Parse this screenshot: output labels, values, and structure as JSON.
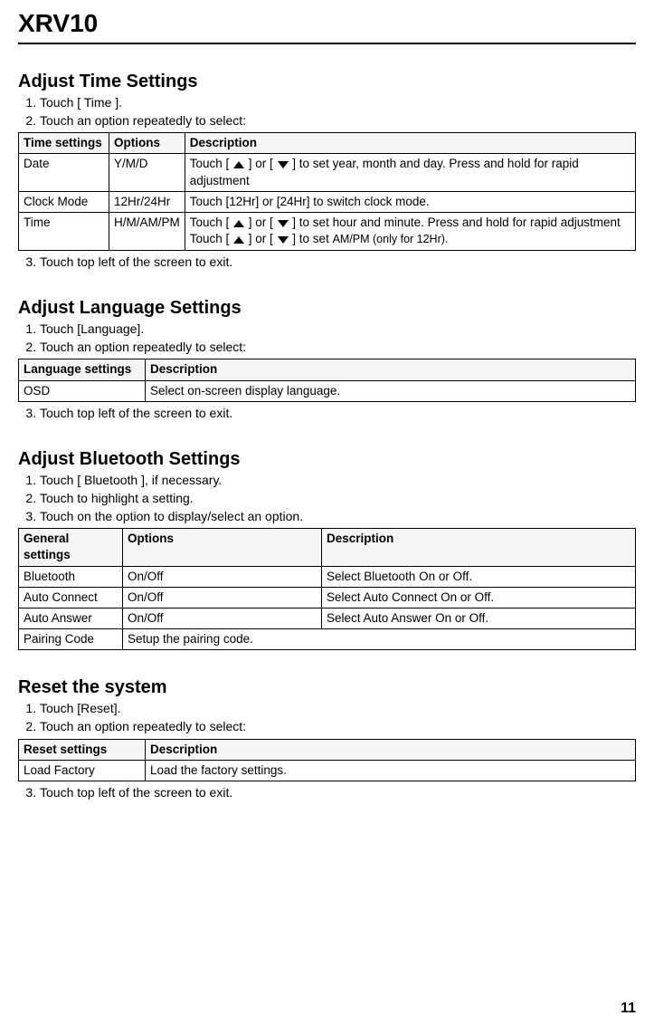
{
  "model": "XRV10",
  "page_number": "11",
  "sections": {
    "time": {
      "heading": "Adjust Time Settings",
      "steps": [
        "Touch [ Time ].",
        "Touch an option repeatedly to select:",
        "Touch top left of the screen to exit."
      ],
      "table": {
        "headers": [
          "Time settings",
          "Options",
          "Description"
        ],
        "rows": [
          {
            "setting": "Date",
            "option": "Y/M/D",
            "desc_before": "Touch [ ",
            "desc_mid": " ] or [ ",
            "desc_after": " ] to set year, month and day. Press and hold for rapid adjustment"
          },
          {
            "setting": "Clock Mode",
            "option": "12Hr/24Hr",
            "desc_plain": "Touch [12Hr] or [24Hr] to switch clock mode."
          },
          {
            "setting": "Time",
            "option": "H/M/AM/PM",
            "line1_before": "Touch [ ",
            "line1_mid": " ] or [ ",
            "line1_after": " ] to set hour and minute. Press and hold for rapid adjustment",
            "line2_before": "Touch [ ",
            "line2_mid": " ] or [ ",
            "line2_after": " ] to set ",
            "line2_tail": "AM/PM (only for 12Hr)."
          }
        ]
      }
    },
    "language": {
      "heading": "Adjust Language Settings",
      "steps": [
        "Touch [Language].",
        "Touch an option repeatedly to select:",
        "Touch top left of the screen to exit."
      ],
      "table": {
        "headers": [
          "Language settings",
          "Description"
        ],
        "rows": [
          {
            "setting": "OSD",
            "desc": "Select on-screen display language."
          }
        ]
      }
    },
    "bluetooth": {
      "heading": "Adjust Bluetooth Settings",
      "steps": [
        "Touch [ Bluetooth ], if necessary.",
        "Touch to highlight a setting.",
        "Touch on the option to display/select an option."
      ],
      "table": {
        "headers": [
          "General settings",
          "Options",
          "Description"
        ],
        "rows": [
          {
            "setting": "Bluetooth",
            "option": "On/Off",
            "desc": "Select Bluetooth On or Off."
          },
          {
            "setting": "Auto Connect",
            "option": "On/Off",
            "desc": "Select Auto Connect On or Off."
          },
          {
            "setting": "Auto Answer",
            "option": "On/Off",
            "desc": "Select Auto Answer On or Off."
          },
          {
            "setting": "Pairing Code",
            "option": "Setup the pairing code.",
            "desc": ""
          }
        ]
      }
    },
    "reset": {
      "heading": "Reset the system",
      "steps": [
        "Touch [Reset].",
        "Touch an option repeatedly to select:",
        "Touch top left of the screen to exit."
      ],
      "table": {
        "headers": [
          "Reset settings",
          "Description"
        ],
        "rows": [
          {
            "setting": "Load Factory",
            "desc": "Load the factory settings."
          }
        ]
      }
    }
  }
}
